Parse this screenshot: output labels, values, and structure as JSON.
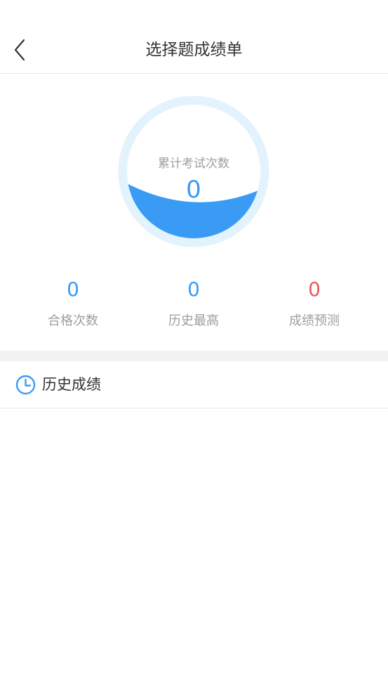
{
  "nav": {
    "title": "选择题成绩单",
    "back_icon": "chevron-left-icon"
  },
  "gauge": {
    "label": "累计考试次数",
    "value": "0",
    "ring_color": "#e3f3fd",
    "fill_color": "#3a9bf5"
  },
  "stats": [
    {
      "value": "0",
      "label": "合格次数",
      "color": "#3a9bf5"
    },
    {
      "value": "0",
      "label": "历史最高",
      "color": "#3a9bf5"
    },
    {
      "value": "0",
      "label": "成绩预测",
      "color": "#ee5a5a"
    }
  ],
  "history": {
    "icon": "clock-icon",
    "title": "历史成绩",
    "items": []
  }
}
